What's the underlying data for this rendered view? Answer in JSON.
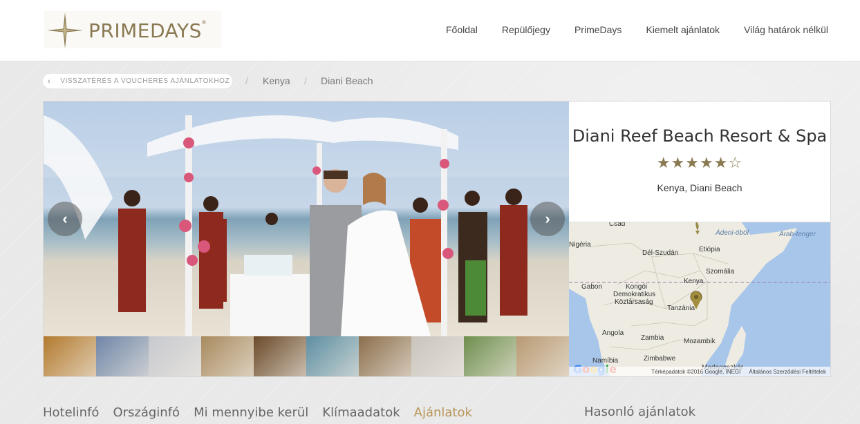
{
  "header": {
    "logo_text": "PRIMEDAYS",
    "logo_reg": "®",
    "nav": [
      "Főoldal",
      "Repülőjegy",
      "PrimeDays",
      "Kiemelt ajánlatok",
      "Világ határok nélkül"
    ]
  },
  "breadcrumb": {
    "back_label": "VISSZATÉRÉS A VOUCHERES AJÁNLATOKHOZ",
    "items": [
      "Kenya",
      "Diani Beach"
    ],
    "separator": "/"
  },
  "hotel": {
    "name": "Diani Reef Beach Resort & Spa",
    "rating": 5,
    "rating_max": 6,
    "stars_text": "★★★★★☆",
    "location": "Kenya, Diani Beach"
  },
  "gallery": {
    "prev_icon": "‹",
    "next_icon": "›",
    "thumb_colors": [
      "#b37a2e",
      "#6f86a8",
      "#c7c9cf",
      "#a88a5e",
      "#6b4a2a",
      "#5d8fa3",
      "#8c6f4c",
      "#c9c5bd",
      "#6f8f4e",
      "#b89a72"
    ]
  },
  "map": {
    "labels": [
      {
        "text": "Csád",
        "sea": false
      },
      {
        "text": "Ádeni-öböl",
        "sea": true
      },
      {
        "text": "Arab-tenger",
        "sea": true
      },
      {
        "text": "Nigéria",
        "sea": false
      },
      {
        "text": "Dél-Szudán",
        "sea": false
      },
      {
        "text": "Etiópia",
        "sea": false
      },
      {
        "text": "Szomália",
        "sea": false
      },
      {
        "text": "Gabon",
        "sea": false
      },
      {
        "text": "Kongói",
        "sea": false
      },
      {
        "text": "Demokratikus",
        "sea": false
      },
      {
        "text": "Köztársaság",
        "sea": false
      },
      {
        "text": "Kenya",
        "sea": false
      },
      {
        "text": "Tanzánia",
        "sea": false
      },
      {
        "text": "Angola",
        "sea": false
      },
      {
        "text": "Zambia",
        "sea": false
      },
      {
        "text": "Mozambik",
        "sea": false
      },
      {
        "text": "Namíbia",
        "sea": false
      },
      {
        "text": "Zimbabwe",
        "sea": false
      },
      {
        "text": "Madagaszkár",
        "sea": false
      }
    ],
    "copyright": "Térképadatok ©2016 Google, INEGI",
    "terms": "Általános Szerződési Feltételek",
    "google": "Google"
  },
  "tabs": [
    "Hotelinfó",
    "Országinfó",
    "Mi mennyibe kerül",
    "Klímaadatok",
    "Ajánlatok"
  ],
  "active_tab": 4,
  "similar_title": "Hasonló ajánlatok",
  "colors": {
    "accent": "#b8965a",
    "gold": "#8a7a52"
  }
}
